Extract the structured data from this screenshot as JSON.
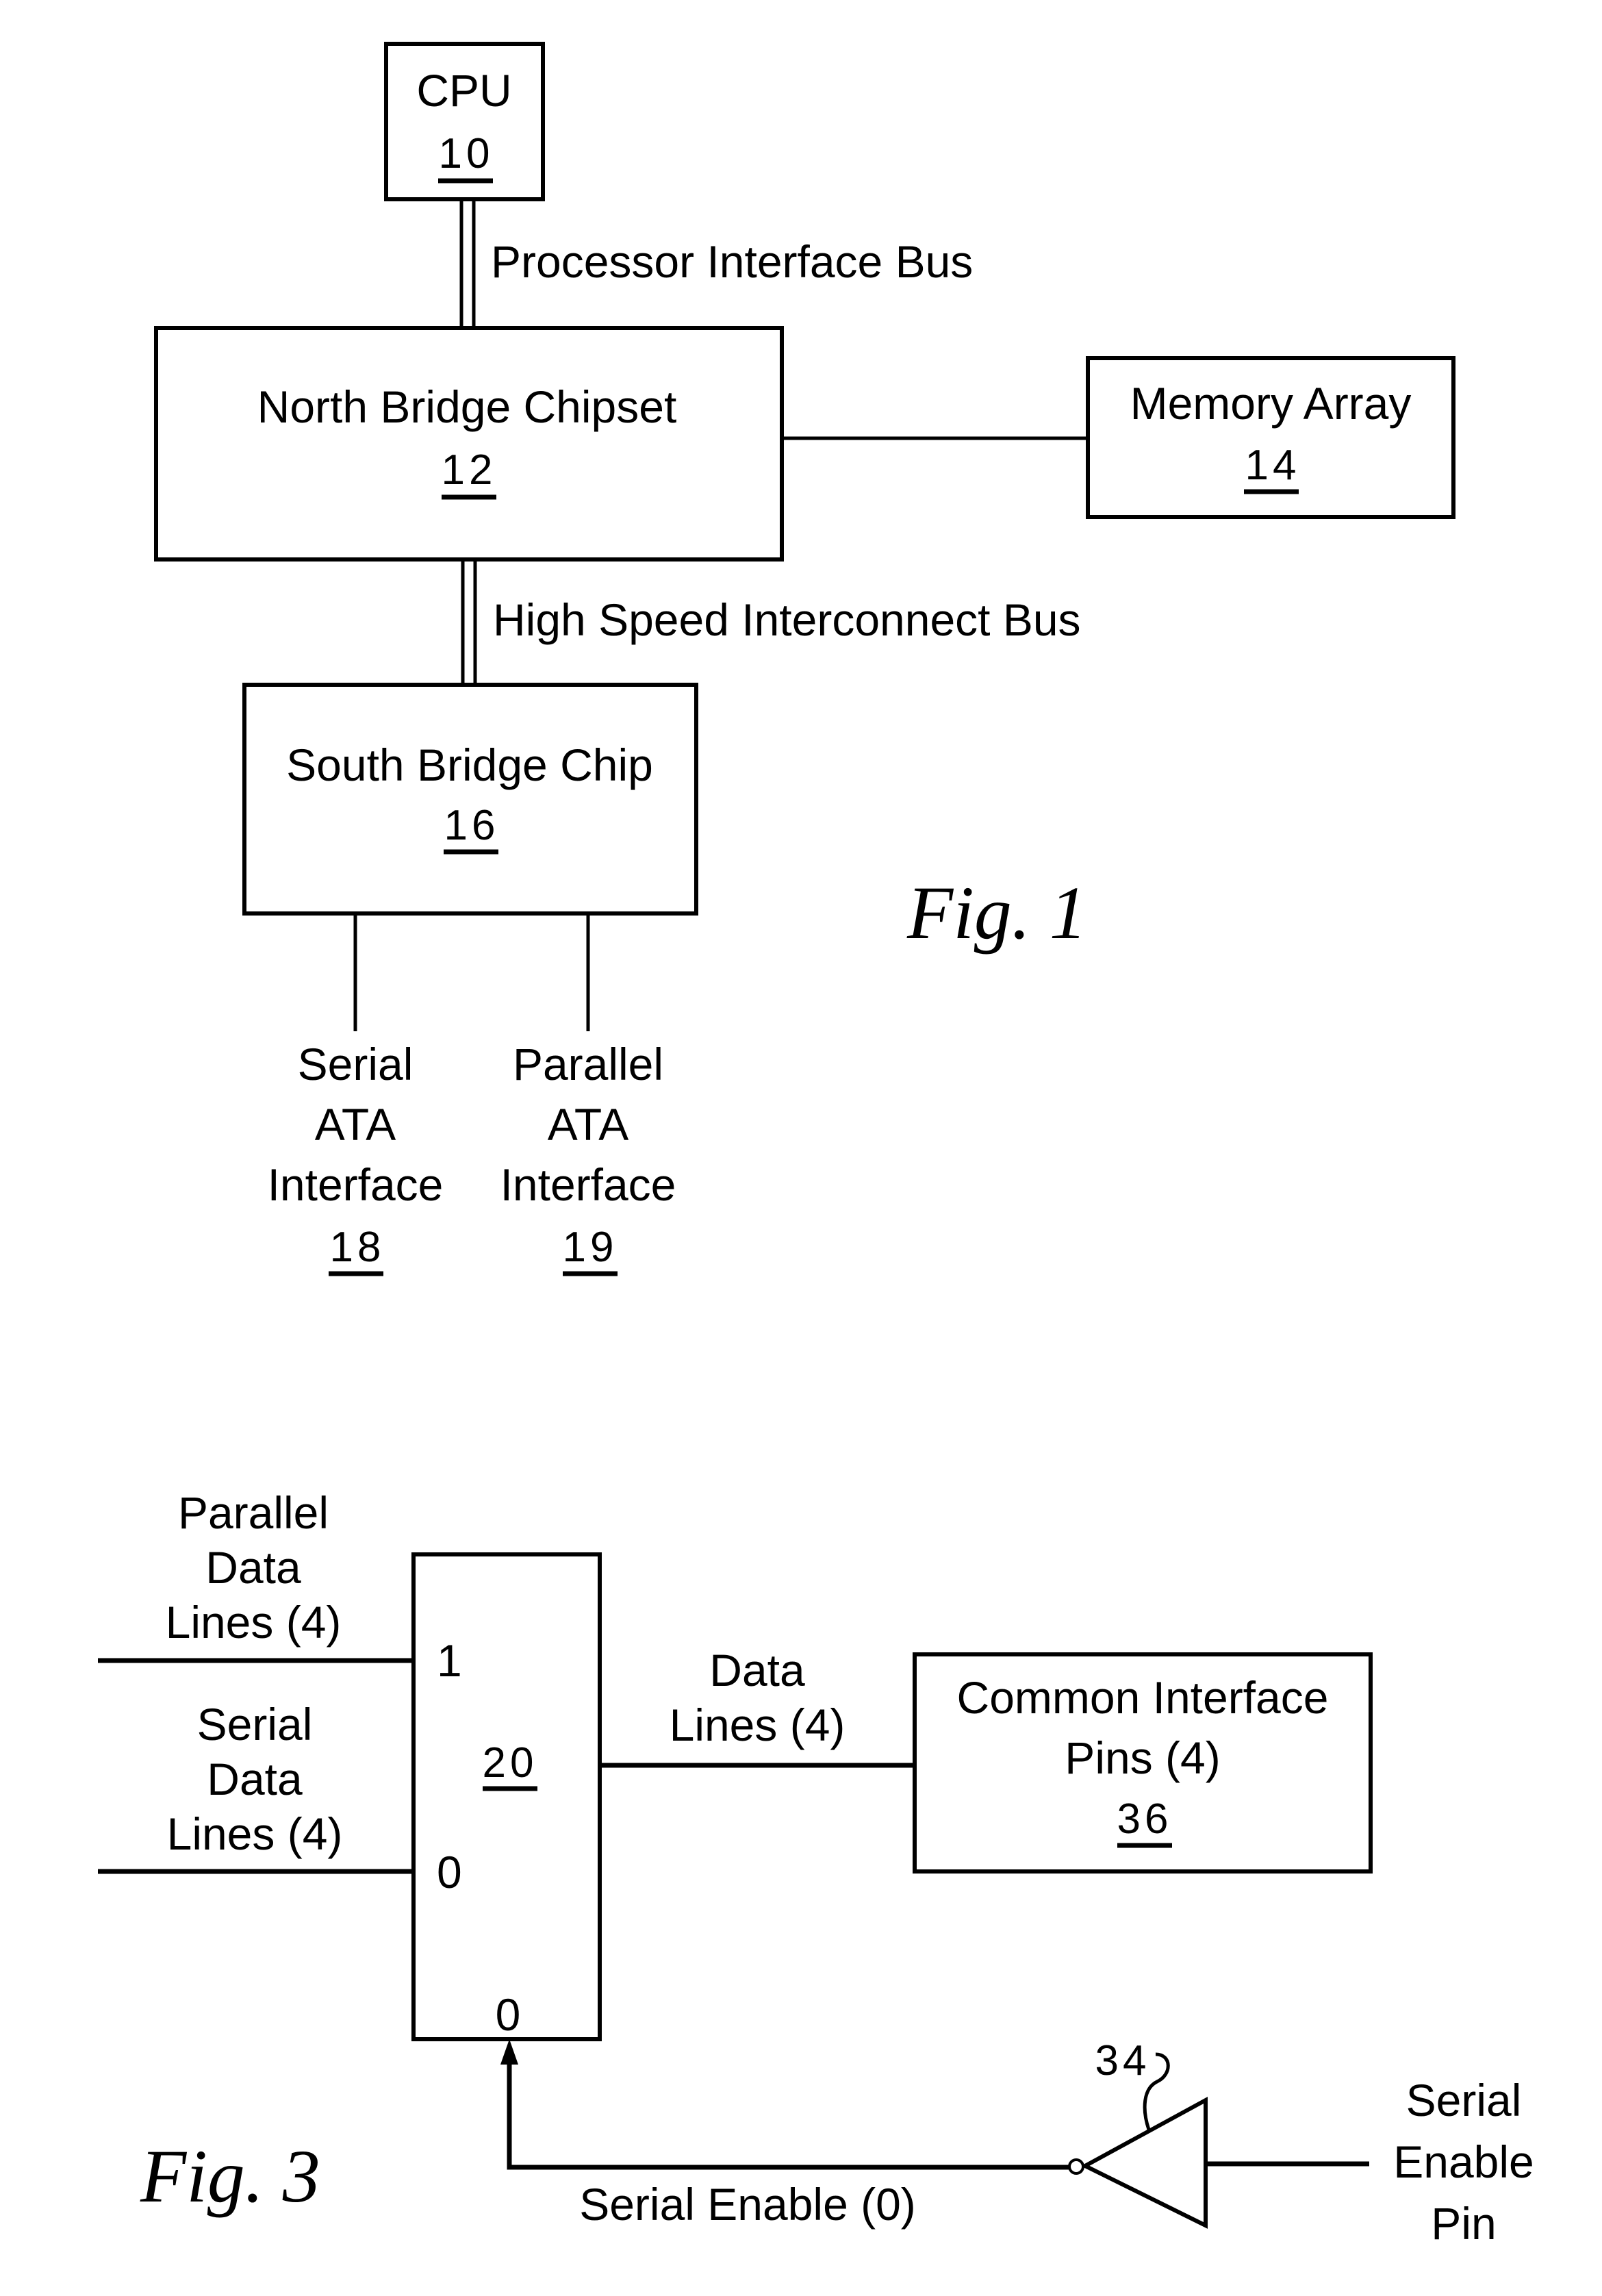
{
  "fig1": {
    "caption": "Fig. 1",
    "cpu": {
      "label": "CPU",
      "ref": "10"
    },
    "processor_bus": {
      "label": "Processor Interface Bus"
    },
    "north_bridge": {
      "label": "North Bridge Chipset",
      "ref": "12"
    },
    "memory": {
      "label": "Memory Array",
      "ref": "14"
    },
    "hs_bus": {
      "label": "High Speed Interconnect Bus"
    },
    "south_bridge": {
      "label": "South Bridge Chip",
      "ref": "16"
    },
    "sata": {
      "lines": [
        "Serial",
        "ATA",
        "Interface"
      ],
      "ref": "18"
    },
    "pata": {
      "lines": [
        "Parallel",
        "ATA",
        "Interface"
      ],
      "ref": "19"
    }
  },
  "fig3": {
    "caption": "Fig. 3",
    "mux": {
      "ref": "20",
      "input1": "1",
      "input0": "0",
      "select": "0"
    },
    "parallel_lines": {
      "lines": [
        "Parallel",
        "Data",
        "Lines (4)"
      ]
    },
    "serial_lines": {
      "lines": [
        "Serial",
        "Data",
        "Lines (4)"
      ]
    },
    "data_lines": {
      "lines": [
        "Data",
        "Lines (4)"
      ]
    },
    "common_pins": {
      "lines": [
        "Common Interface",
        "Pins (4)"
      ],
      "ref": "36"
    },
    "inverter": {
      "ref": "34"
    },
    "serial_enable": {
      "label": "Serial Enable (0)"
    },
    "serial_enable_pin": {
      "lines": [
        "Serial",
        "Enable",
        "Pin"
      ]
    }
  }
}
